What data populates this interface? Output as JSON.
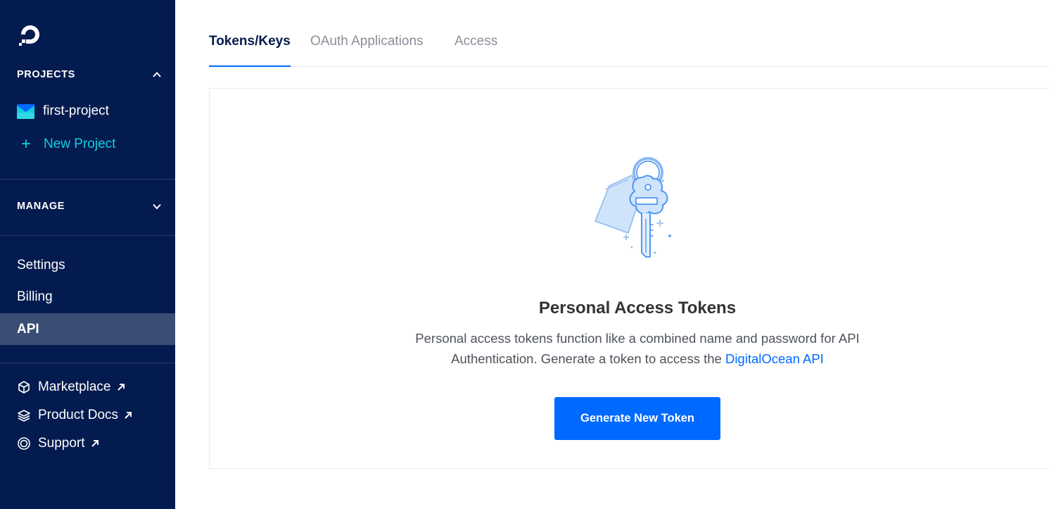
{
  "sidebar": {
    "projects_header": "PROJECTS",
    "projects": [
      {
        "label": "first-project"
      }
    ],
    "new_project_label": "New Project",
    "manage_header": "MANAGE",
    "nav": [
      {
        "label": "Settings"
      },
      {
        "label": "Billing"
      },
      {
        "label": "API",
        "active": true
      }
    ],
    "links": [
      {
        "label": "Marketplace",
        "icon": "cube-icon"
      },
      {
        "label": "Product Docs",
        "icon": "layers-icon"
      },
      {
        "label": "Support",
        "icon": "lifebuoy-icon"
      }
    ]
  },
  "tabs": [
    {
      "label": "Tokens/Keys",
      "active": true
    },
    {
      "label": "OAuth Applications"
    },
    {
      "label": "Access"
    }
  ],
  "empty_state": {
    "illustration": "key-illustration",
    "title": "Personal Access Tokens",
    "description_line1": "Personal access tokens function like a combined name and password for API",
    "description_line2": "Authentication. Generate a token to access the",
    "link_label": "DigitalOcean API",
    "button_label": "Generate New Token"
  },
  "colors": {
    "sidebar_bg": "#031b4e",
    "sidebar_active_bg": "#3a4d74",
    "accent_teal": "#15cddf",
    "primary_blue": "#0069ff"
  }
}
